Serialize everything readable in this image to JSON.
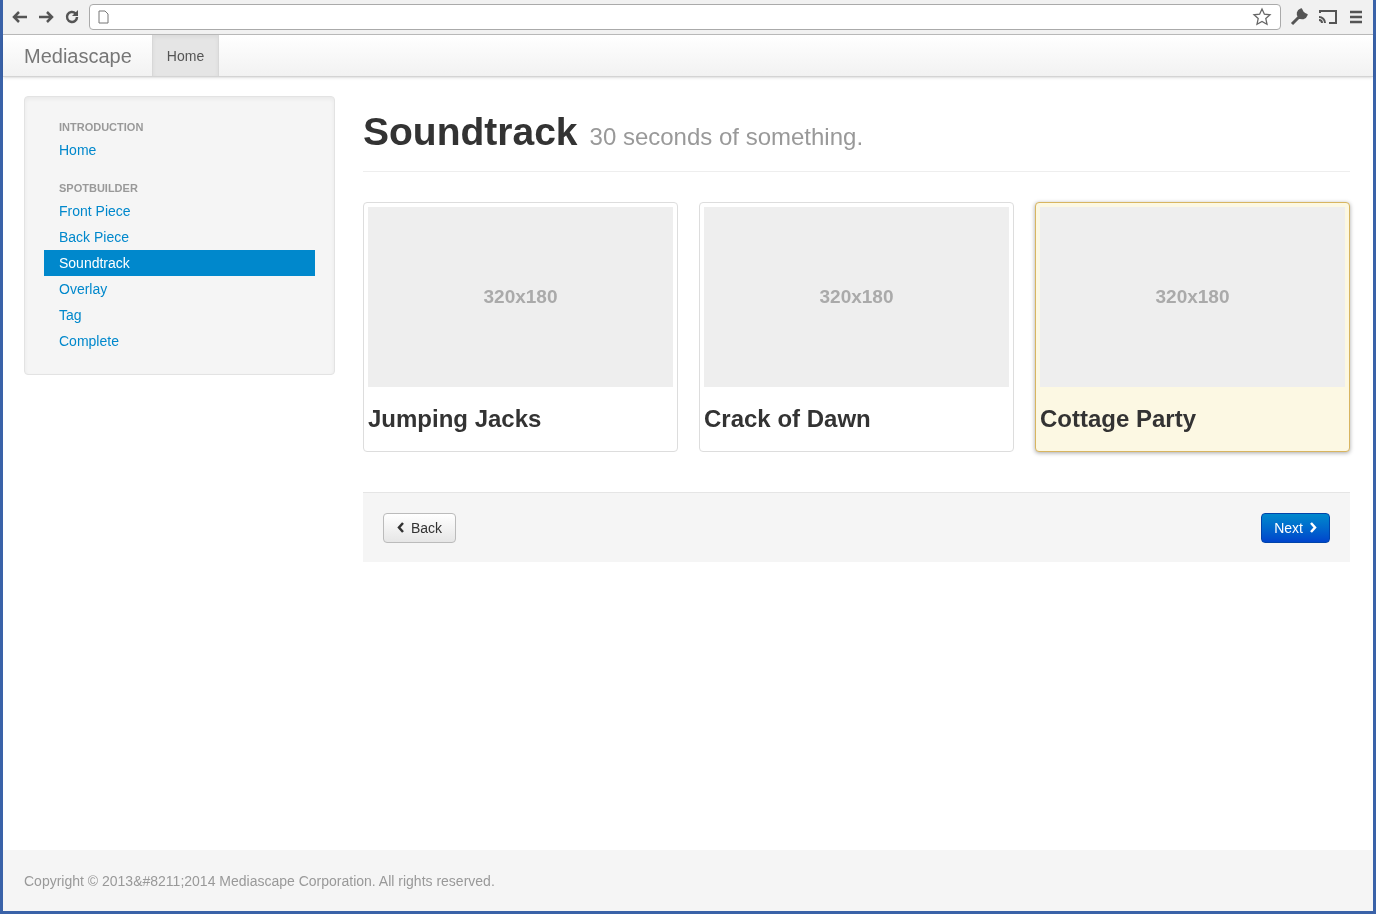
{
  "navbar": {
    "brand": "Mediascape",
    "tabs": [
      {
        "label": "Home",
        "selected": true
      }
    ]
  },
  "sidebar": {
    "sections": [
      {
        "heading": "INTRODUCTION",
        "items": [
          {
            "label": "Home",
            "selected": false
          }
        ]
      },
      {
        "heading": "SPOTBUILDER",
        "items": [
          {
            "label": "Front Piece",
            "selected": false
          },
          {
            "label": "Back Piece",
            "selected": false
          },
          {
            "label": "Soundtrack",
            "selected": true
          },
          {
            "label": "Overlay",
            "selected": false
          },
          {
            "label": "Tag",
            "selected": false
          },
          {
            "label": "Complete",
            "selected": false
          }
        ]
      }
    ]
  },
  "page": {
    "title": "Soundtrack",
    "subtitle": "30 seconds of something."
  },
  "cards": [
    {
      "placeholder": "320x180",
      "title": "Jumping Jacks",
      "selected": false
    },
    {
      "placeholder": "320x180",
      "title": "Crack of Dawn",
      "selected": false
    },
    {
      "placeholder": "320x180",
      "title": "Cottage Party",
      "selected": true
    }
  ],
  "pager": {
    "back": "Back",
    "next": "Next"
  },
  "footer": "Copyright © 2013&#8211;2014 Mediascape Corporation. All rights reserved."
}
